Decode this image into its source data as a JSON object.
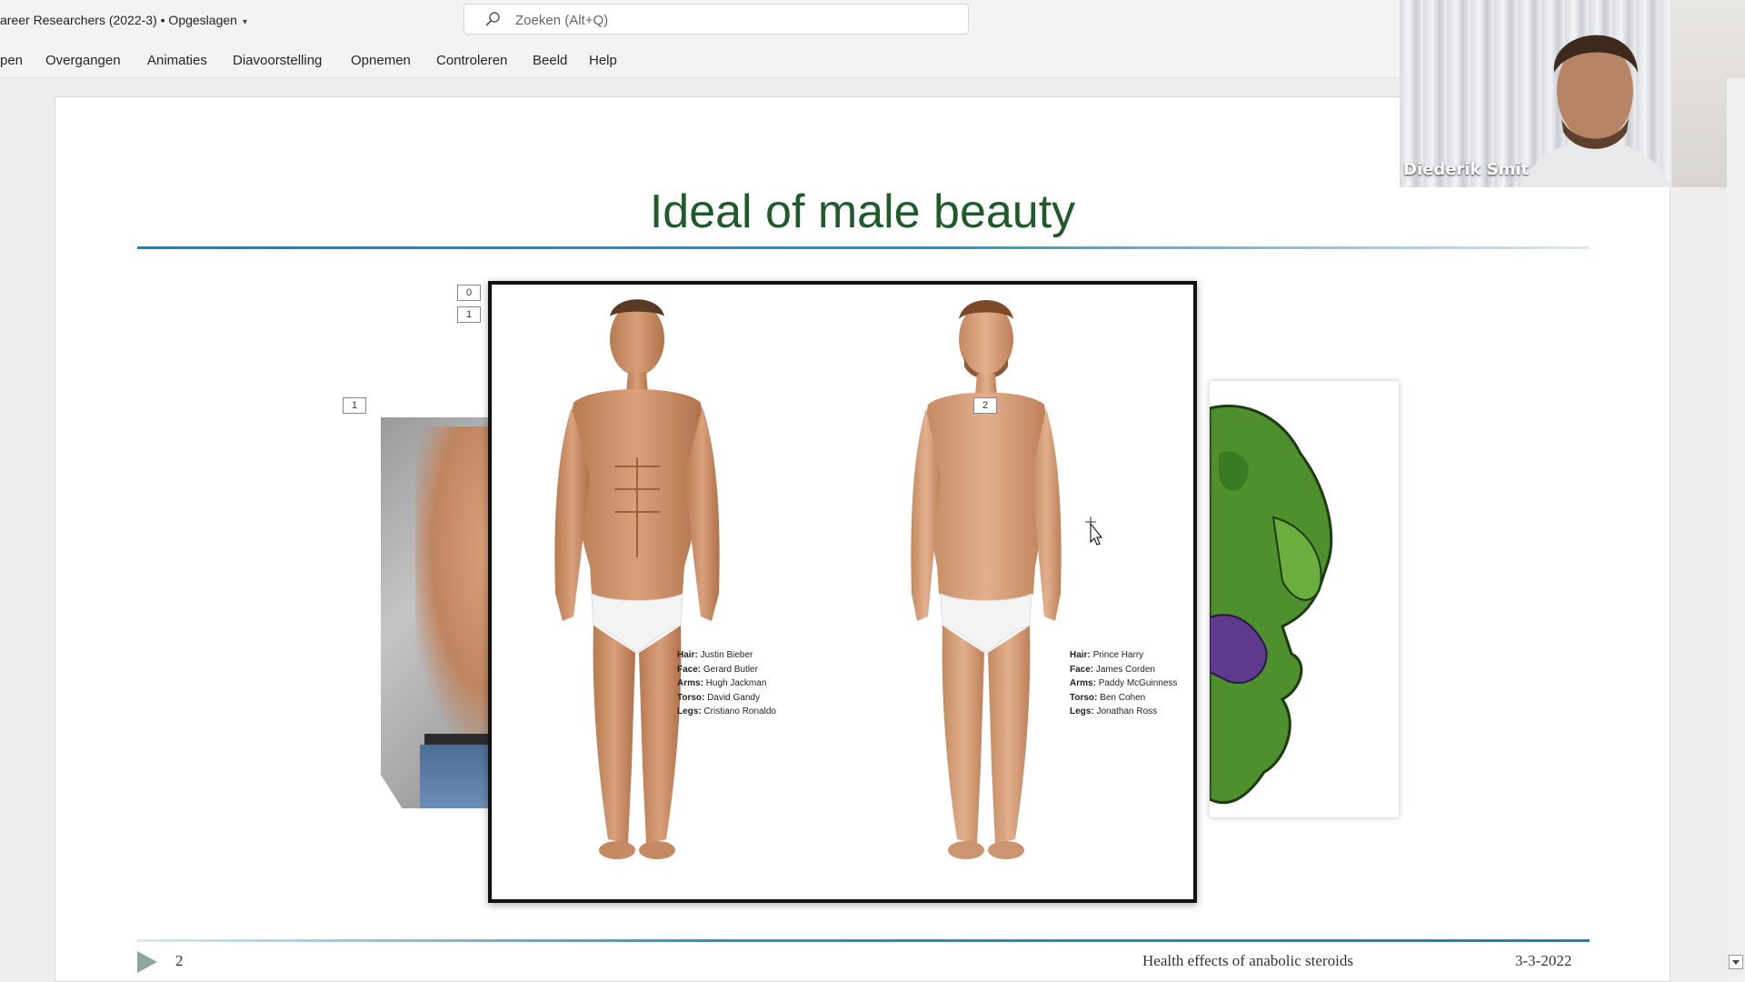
{
  "titlebar": {
    "doc_title": "areer Researchers (2022-3) • Opgeslagen",
    "search_placeholder": "Zoeken (Alt+Q)"
  },
  "ribbon": {
    "tabs": [
      "pen",
      "Overgangen",
      "Animaties",
      "Diavoorstelling",
      "Opnemen",
      "Controleren",
      "Beeld",
      "Help"
    ]
  },
  "slide": {
    "title": "Ideal of male beauty",
    "image_labels": [
      "0",
      "1",
      "1",
      "2"
    ],
    "figure_left_credits": [
      {
        "key": "Hair:",
        "value": "Justin Bieber"
      },
      {
        "key": "Face:",
        "value": "Gerard Butler"
      },
      {
        "key": "Arms:",
        "value": "Hugh Jackman"
      },
      {
        "key": "Torso:",
        "value": "David Gandy"
      },
      {
        "key": "Legs:",
        "value": "Cristiano Ronaldo"
      }
    ],
    "figure_right_credits": [
      {
        "key": "Hair:",
        "value": "Prince Harry"
      },
      {
        "key": "Face:",
        "value": "James Corden"
      },
      {
        "key": "Arms:",
        "value": "Paddy McGuinness"
      },
      {
        "key": "Torso:",
        "value": "Ben Cohen"
      },
      {
        "key": "Legs:",
        "value": "Jonathan Ross"
      }
    ],
    "footer": {
      "slide_number": "2",
      "topic": "Health effects of anabolic steroids",
      "date": "3-3-2022"
    }
  },
  "webcam": {
    "participant_name": "Diederik Smit"
  },
  "colors": {
    "title_green": "#1e5a2a",
    "rule_blue": "#1f7fb6"
  }
}
